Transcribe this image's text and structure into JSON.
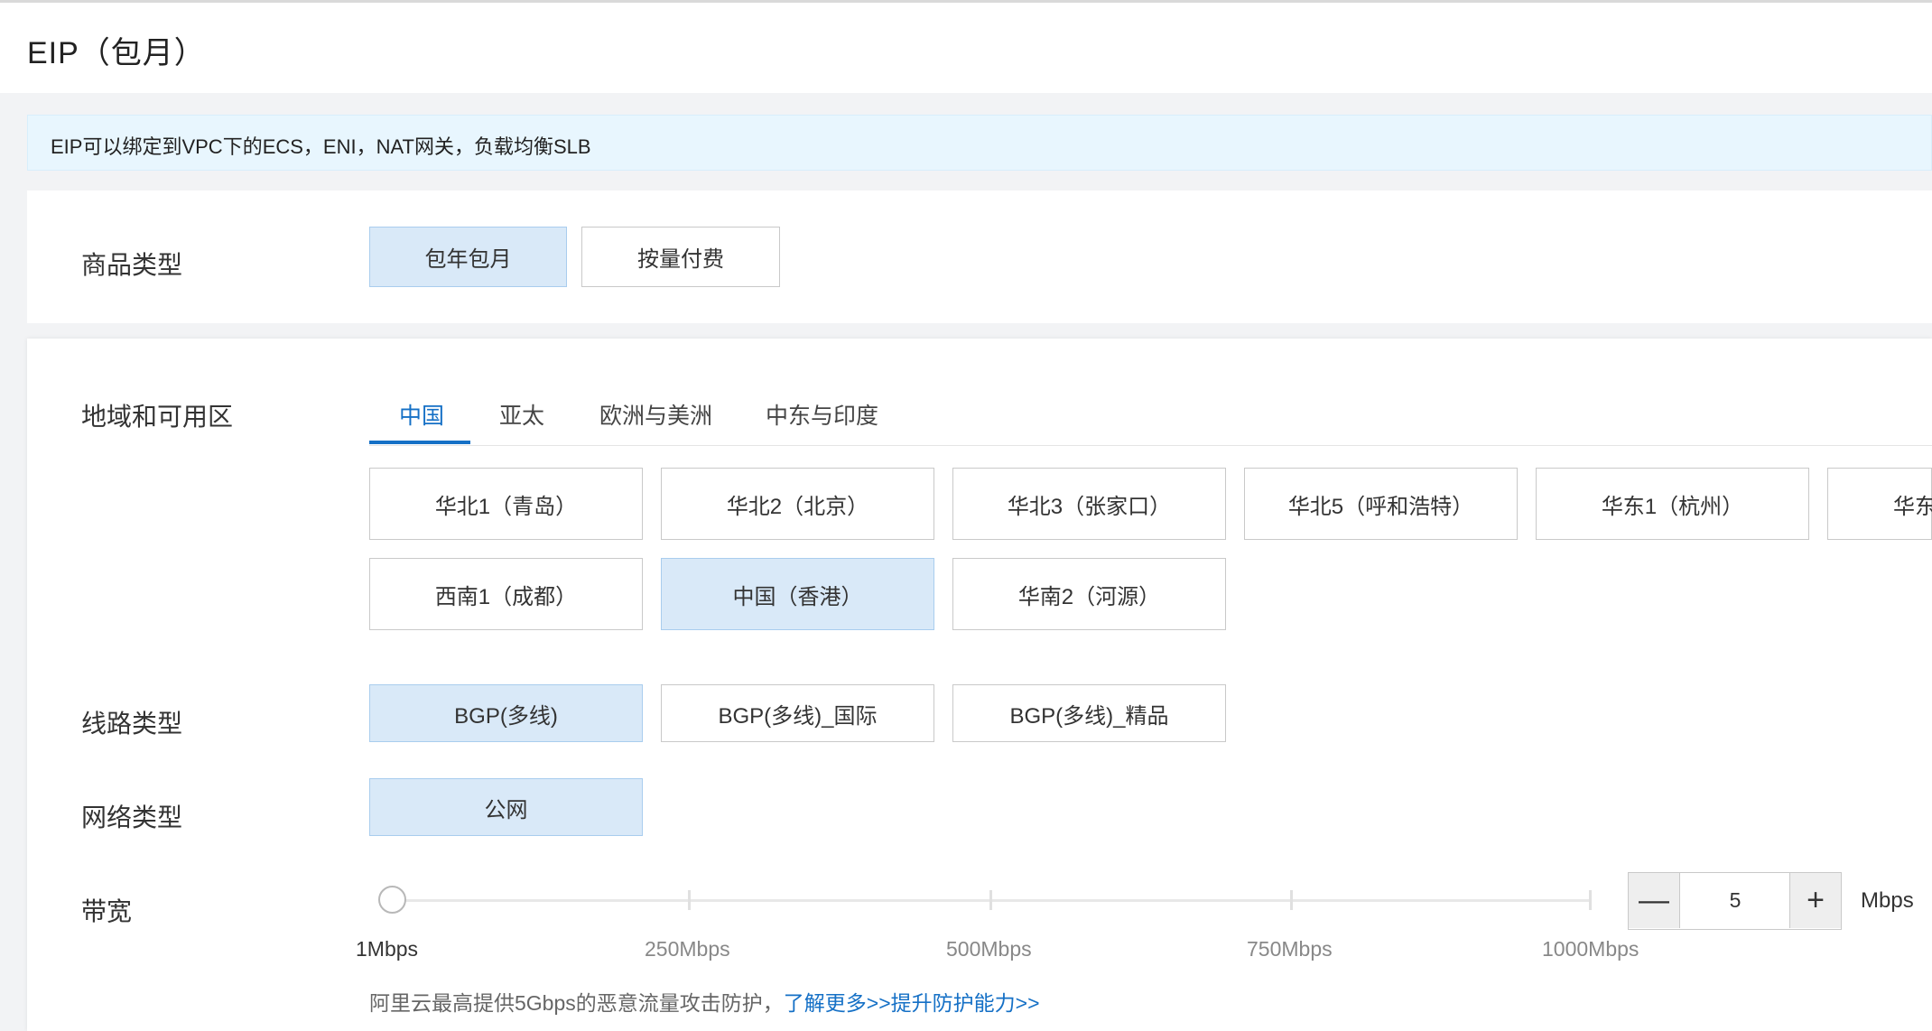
{
  "page": {
    "title": "EIP（包月）"
  },
  "notice": {
    "text": "EIP可以绑定到VPC下的ECS，ENI，NAT网关，负载均衡SLB"
  },
  "product_type": {
    "label": "商品类型",
    "options": [
      "包年包月",
      "按量付费"
    ],
    "selected": "包年包月"
  },
  "region": {
    "label": "地域和可用区",
    "tabs": [
      "中国",
      "亚太",
      "欧洲与美洲",
      "中东与印度"
    ],
    "active_tab": "中国",
    "options": [
      "华北1（青岛）",
      "华北2（北京）",
      "华北3（张家口）",
      "华北5（呼和浩特）",
      "华东1（杭州）",
      "华东",
      "西南1（成都）",
      "中国（香港）",
      "华南2（河源）"
    ],
    "selected": "中国（香港）"
  },
  "line_type": {
    "label": "线路类型",
    "options": [
      "BGP(多线)",
      "BGP(多线)_国际",
      "BGP(多线)_精品"
    ],
    "selected": "BGP(多线)"
  },
  "network_type": {
    "label": "网络类型",
    "options": [
      "公网"
    ],
    "selected": "公网"
  },
  "bandwidth": {
    "label": "带宽",
    "ticks": [
      "1Mbps",
      "250Mbps",
      "500Mbps",
      "750Mbps",
      "1000Mbps"
    ],
    "min": 1,
    "max": 1000,
    "value": "5",
    "minus": "—",
    "plus": "+",
    "unit": "Mbps"
  },
  "protection_note": {
    "text": "阿里云最高提供5Gbps的恶意流量攻击防护，",
    "link_learn": "了解更多>>",
    "link_upgrade": "提升防护能力>>"
  },
  "colors": {
    "accent": "#1570c6",
    "selected_bg": "#d9e9f8",
    "notice_bg": "#e8f6fe"
  }
}
